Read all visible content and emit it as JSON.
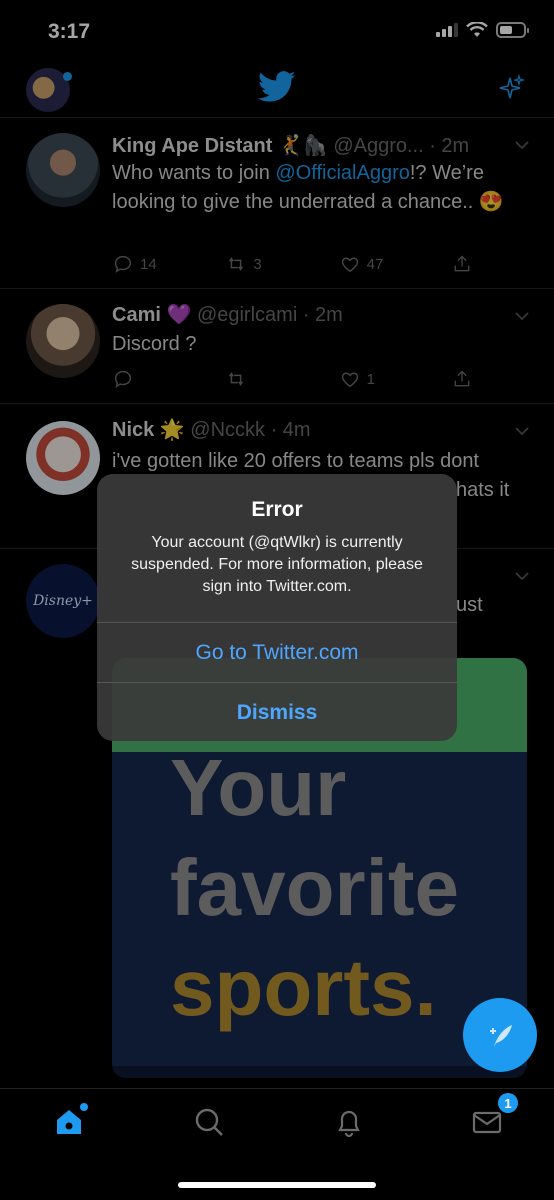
{
  "status_bar": {
    "time": "3:17",
    "battery_level": 0.55
  },
  "header": {
    "logo_icon": "twitter-bird-icon",
    "sparkle_icon": "sparkle-icon"
  },
  "tweets": [
    {
      "name": "King Ape Distant",
      "badge": "🤾🦍",
      "handle": "@Aggro...",
      "time": "· 2m",
      "text_before": "Who wants to join ",
      "mention": "@OfficialAggro",
      "text_after": "!? We’re looking to give the underrated a chance.. 😍",
      "replies": "14",
      "retweets": "3",
      "likes": "47"
    },
    {
      "name": "Cami",
      "badge": "💜",
      "handle": "@egirlcami",
      "time": "· 2m",
      "text": "Discord ?",
      "replies": "",
      "retweets": "",
      "likes": "1"
    },
    {
      "name": "Nick",
      "badge": "🌟",
      "handle": "@Ncckk",
      "time": "· 4m",
      "text": "i've gotten like 20 offers to teams pls dont",
      "text_tail": "hats it"
    },
    {
      "avatar_label": "Disney+",
      "text_tail": "ust"
    }
  ],
  "ad": {
    "line1": "Your",
    "line2": "favorite",
    "line3": "sports."
  },
  "alert": {
    "title": "Error",
    "message": "Your account (@qtWlkr) is currently suspended. For more information, please sign into Twitter.com.",
    "primary_button": "Go to Twitter.com",
    "secondary_button": "Dismiss"
  },
  "tabbar": {
    "messages_badge": "1"
  },
  "colors": {
    "accent": "#1d9bf0",
    "alert_link": "#4ea6ff",
    "background": "#000000"
  }
}
